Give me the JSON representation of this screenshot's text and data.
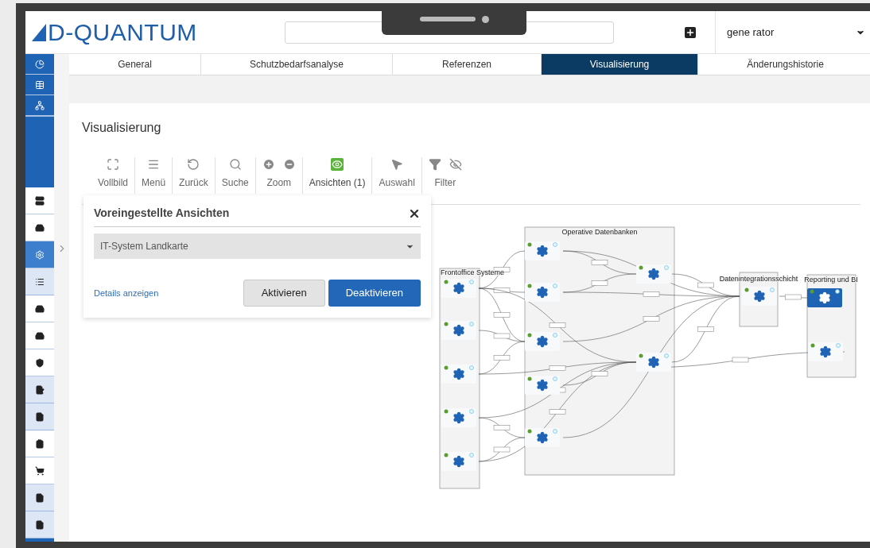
{
  "header": {
    "logo": "D-QUANTUM",
    "user": "gene rator"
  },
  "sidebar": {
    "items": [
      {
        "kind": "nav",
        "selected": false
      },
      {
        "kind": "nav",
        "selected": false
      },
      {
        "kind": "nav",
        "selected": false
      },
      {
        "kind": "module",
        "selected": false,
        "shaded": false
      },
      {
        "kind": "module",
        "selected": false,
        "shaded": false
      },
      {
        "kind": "module",
        "selected": true,
        "shaded": false
      },
      {
        "kind": "module",
        "selected": false,
        "shaded": true
      },
      {
        "kind": "module",
        "selected": false,
        "shaded": false
      },
      {
        "kind": "module",
        "selected": false,
        "shaded": false
      },
      {
        "kind": "module",
        "selected": false,
        "shaded": false
      },
      {
        "kind": "module",
        "selected": false,
        "shaded": true
      },
      {
        "kind": "module",
        "selected": false,
        "shaded": true
      },
      {
        "kind": "module",
        "selected": false,
        "shaded": false
      },
      {
        "kind": "module",
        "selected": false,
        "shaded": false
      },
      {
        "kind": "module",
        "selected": false,
        "shaded": true
      },
      {
        "kind": "module",
        "selected": false,
        "shaded": true
      }
    ]
  },
  "tabs": [
    {
      "label": "General",
      "selected": false
    },
    {
      "label": "Schutzbedarfsanalyse",
      "selected": false
    },
    {
      "label": "Referenzen",
      "selected": false
    },
    {
      "label": "Visualisierung",
      "selected": true
    },
    {
      "label": "Änderungshistorie",
      "selected": false
    }
  ],
  "page_title": "Visualisierung",
  "toolbar": [
    {
      "label": "Vollbild",
      "active": false
    },
    {
      "label": "Menü",
      "active": false
    },
    {
      "label": "Zurück",
      "active": false
    },
    {
      "label": "Suche",
      "active": false
    },
    {
      "label": "Zoom",
      "active": false
    },
    {
      "label": "Ansichten (1)",
      "active": true
    },
    {
      "label": "Auswahl",
      "active": false
    },
    {
      "label": "Filter",
      "active": false
    }
  ],
  "views_panel": {
    "title": "Voreingestellte Ansichten",
    "select_value": "IT-System Landkarte",
    "link": "Details anzeigen",
    "buttons": [
      {
        "label": "Aktivieren",
        "primary": false
      },
      {
        "label": "Deaktivieren",
        "primary": true
      }
    ]
  },
  "diagram": {
    "groups": [
      {
        "title": "Frontoffice Systeme",
        "nodes": [
          {
            "selected": false
          },
          {
            "selected": false
          },
          {
            "selected": false
          },
          {
            "selected": false
          },
          {
            "selected": false
          }
        ]
      },
      {
        "title": "Operative Datenbanken",
        "nodes": [
          {
            "selected": false
          },
          {
            "selected": false
          },
          {
            "selected": false
          },
          {
            "selected": false
          },
          {
            "selected": false
          },
          {
            "selected": false
          },
          {
            "selected": false
          }
        ]
      },
      {
        "title": "Datenintegrationsschicht",
        "nodes": [
          {
            "selected": false
          }
        ]
      },
      {
        "title": "Reporting und BI",
        "nodes": [
          {
            "selected": true
          },
          {
            "selected": false
          }
        ]
      }
    ]
  }
}
